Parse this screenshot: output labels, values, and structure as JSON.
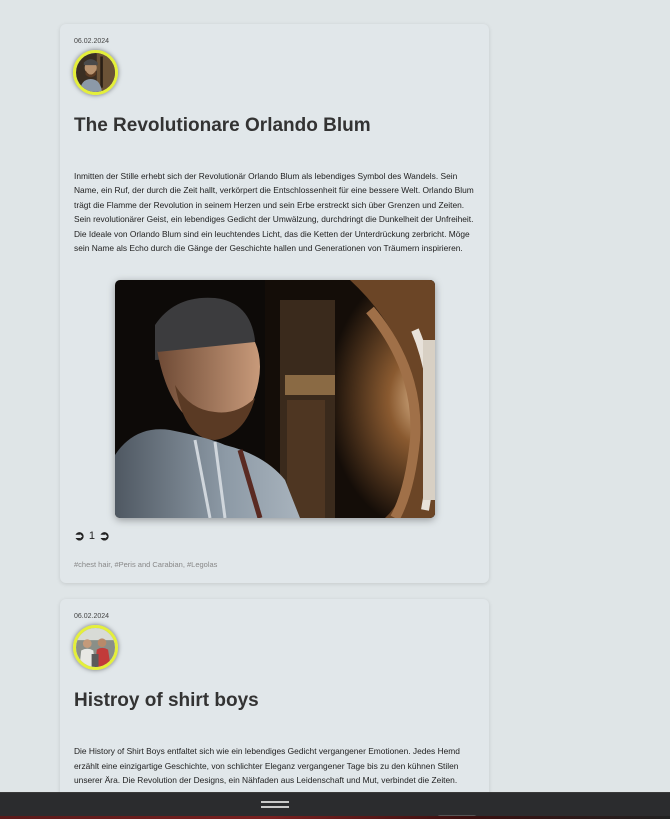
{
  "posts": [
    {
      "date": "06.02.2024",
      "title": "The Revolutionare Orlando Blum",
      "body": "Inmitten der Stille erhebt sich der Revolutionär Orlando Blum als lebendiges Symbol des Wandels. Sein Name, ein Ruf, der durch die Zeit hallt, verkörpert die Entschlossenheit für eine bessere Welt. Orlando Blum trägt die Flamme der Revolution in seinem Herzen und sein Erbe erstreckt sich über Grenzen und Zeiten. Sein revolutionärer Geist, ein lebendiges Gedicht der Umwälzung, durchdringt die Dunkelheit der Unfreiheit. Die Ideale von Orlando Blum sind ein leuchtendes Licht, das die Ketten der Unterdrückung zerbricht. Möge sein Name als Echo durch die Gänge der Geschichte hallen und Generationen von Träumern inspirieren.",
      "reaction_left": "➲",
      "reaction_count": "1",
      "reaction_right": "➲",
      "tags": "#chest hair, #Peris and Carabian, #Legolas",
      "image_icon": "bearded-man-photo"
    },
    {
      "date": "06.02.2024",
      "title": "Histroy of shirt boys",
      "body": "Die History of Shirt Boys entfaltet sich wie ein lebendiges Gedicht vergangener Emotionen. Jedes Hemd erzählt eine einzigartige Geschichte, von schlichter Eleganz vergangener Tage bis zu den kühnen Stilen unserer Ära. Die Revolution der Designs, ein Nähfaden aus Leidenschaft und Mut, verbindet die Zeiten.",
      "image_icon": "group-photo"
    }
  ],
  "colors": {
    "avatar_ring": "#e4ef3a",
    "background": "#dfe5e7",
    "bottom_bar": "#2b2c2e"
  }
}
